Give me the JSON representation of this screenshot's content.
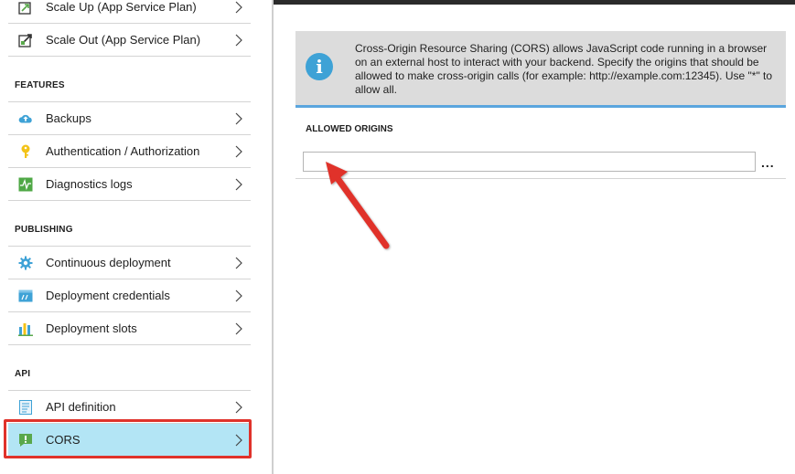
{
  "sidebar": {
    "top_items": [
      {
        "label": "Scale Up (App Service Plan)",
        "icon": "scale-up-icon"
      },
      {
        "label": "Scale Out (App Service Plan)",
        "icon": "scale-out-icon"
      }
    ],
    "sections": {
      "features": "FEATURES",
      "publishing": "PUBLISHING",
      "api": "API"
    },
    "features_items": [
      {
        "label": "Backups",
        "icon": "cloud-backup-icon"
      },
      {
        "label": "Authentication / Authorization",
        "icon": "key-icon"
      },
      {
        "label": "Diagnostics logs",
        "icon": "diagnostics-icon"
      }
    ],
    "publishing_items": [
      {
        "label": "Continuous deployment",
        "icon": "gear-icon"
      },
      {
        "label": "Deployment credentials",
        "icon": "credentials-icon"
      },
      {
        "label": "Deployment slots",
        "icon": "slots-icon"
      }
    ],
    "api_items": [
      {
        "label": "API definition",
        "icon": "api-document-icon"
      },
      {
        "label": "CORS",
        "icon": "cors-icon"
      }
    ]
  },
  "main": {
    "info_text": "Cross-Origin Resource Sharing (CORS) allows JavaScript code running in a browser on an external host to interact with your backend. Specify the origins that should be allowed to make cross-origin calls (for example: http://example.com:12345). Use \"*\" to allow all.",
    "allowed_origins_label": "ALLOWED ORIGINS",
    "origin_input_value": "",
    "more_label": "..."
  },
  "colors": {
    "selected_bg": "#b3e5f5",
    "highlight_border": "#e0322a",
    "info_accent": "#5aa5de",
    "arrow": "#e0322a"
  }
}
